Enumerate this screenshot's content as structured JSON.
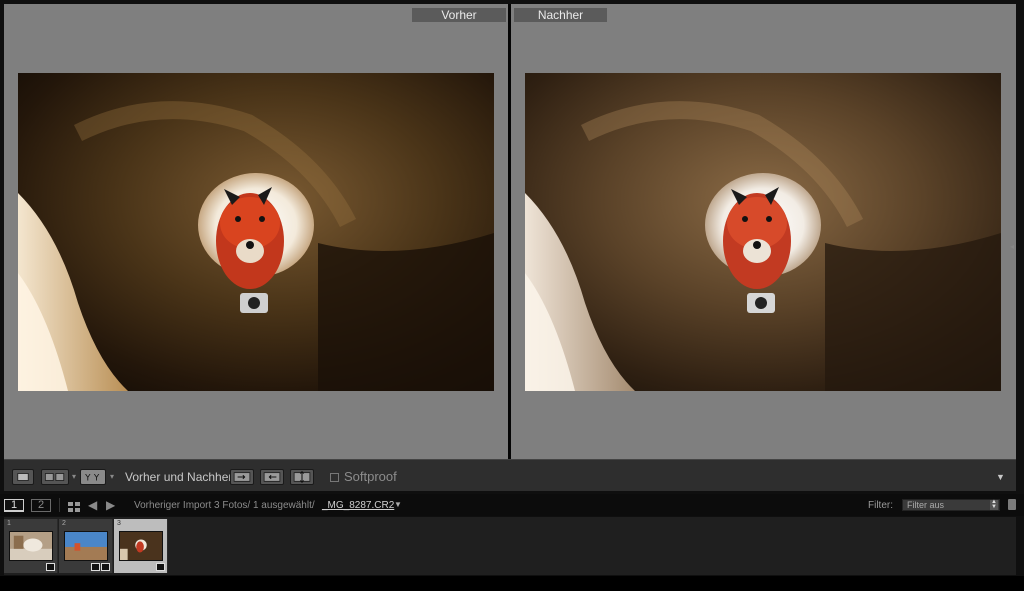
{
  "compare": {
    "before_label": "Vorher",
    "after_label": "Nachher"
  },
  "toolbar": {
    "view_mode_label": "Vorher und Nachher:",
    "softproof_label": "Softproof",
    "softproof_checked": false,
    "icons": [
      "loupe-view-icon",
      "compare-view-icon",
      "before-after-left-right-icon",
      "copy-before-to-after-icon",
      "copy-after-to-before-icon",
      "swap-before-after-icon",
      "toolbar-menu-icon"
    ]
  },
  "filmstrip_nav": {
    "screen_1": "1",
    "screen_2": "2",
    "source_text": "Vorheriger Import   3 Fotos/ 1 ausgewählt/",
    "current_file": "_MG_8287.CR2",
    "filter_label": "Filter:",
    "filter_value": "Filter aus"
  },
  "filmstrip": {
    "thumbnails": [
      {
        "index": "1",
        "selected": false
      },
      {
        "index": "2",
        "selected": false
      },
      {
        "index": "3",
        "selected": true
      }
    ]
  },
  "colors": {
    "panel_bg": "#7f7f7f",
    "label_bg": "#5b5b5b",
    "toolbar_bg": "#2e2e2e",
    "selected_thumb": "#bdbdbd"
  }
}
